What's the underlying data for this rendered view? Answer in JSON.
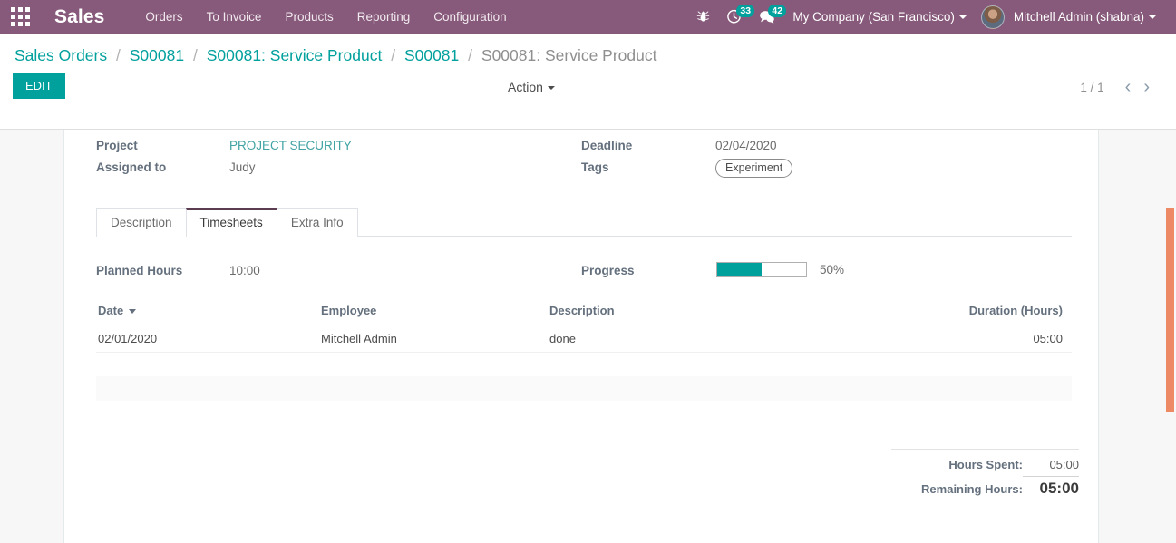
{
  "navbar": {
    "apps_icon": "apps-grid-icon",
    "brand": "Sales",
    "menu": [
      {
        "label": "Orders"
      },
      {
        "label": "To Invoice"
      },
      {
        "label": "Products"
      },
      {
        "label": "Reporting"
      },
      {
        "label": "Configuration"
      }
    ],
    "bug_icon": "bug-icon",
    "activities_icon": "clock-icon",
    "activities_count": "33",
    "messages_icon": "chat-bubble-icon",
    "messages_count": "42",
    "company": "My Company (San Francisco)",
    "user": "Mitchell Admin (shabna)",
    "avatar_icon": "user-avatar"
  },
  "breadcrumb": {
    "items": [
      {
        "label": "Sales Orders",
        "active": false
      },
      {
        "label": "S00081",
        "active": false
      },
      {
        "label": "S00081: Service Product",
        "active": false
      },
      {
        "label": "S00081",
        "active": false
      },
      {
        "label": "S00081: Service Product",
        "active": true
      }
    ],
    "separator": "/"
  },
  "control_panel": {
    "edit_label": "EDIT",
    "action_label": "Action",
    "pager_count": "1 / 1",
    "prev_icon": "chevron-left-icon",
    "next_icon": "chevron-right-icon"
  },
  "form": {
    "project_label": "Project",
    "project_value": "PROJECT SECURITY",
    "assigned_label": "Assigned to",
    "assigned_value": "Judy",
    "deadline_label": "Deadline",
    "deadline_value": "02/04/2020",
    "tags_label": "Tags",
    "tag_value": "Experiment"
  },
  "tabs": [
    {
      "label": "Description",
      "active": false
    },
    {
      "label": "Timesheets",
      "active": true
    },
    {
      "label": "Extra Info",
      "active": false
    }
  ],
  "timesheets": {
    "planned_hours_label": "Planned Hours",
    "planned_hours_value": "10:00",
    "progress_label": "Progress",
    "progress_percent": 50,
    "progress_text": "50%",
    "columns": [
      {
        "label": "Date",
        "sorted": true,
        "sort_icon": "sort-desc-caret"
      },
      {
        "label": "Employee",
        "sorted": false
      },
      {
        "label": "Description",
        "sorted": false
      },
      {
        "label": "Duration (Hours)",
        "sorted": false
      }
    ],
    "rows": [
      {
        "date": "02/01/2020",
        "employee": "Mitchell Admin",
        "description": "done",
        "duration": "05:00"
      }
    ],
    "totals": {
      "hours_spent_label": "Hours Spent:",
      "hours_spent_value": "05:00",
      "remaining_label": "Remaining Hours:",
      "remaining_value": "05:00"
    }
  },
  "colors": {
    "brand_purple": "#875A7B",
    "accent_teal": "#00A09D",
    "scrollbar_orange": "#ED8A65",
    "active_tab_border": "#5C3C51"
  }
}
